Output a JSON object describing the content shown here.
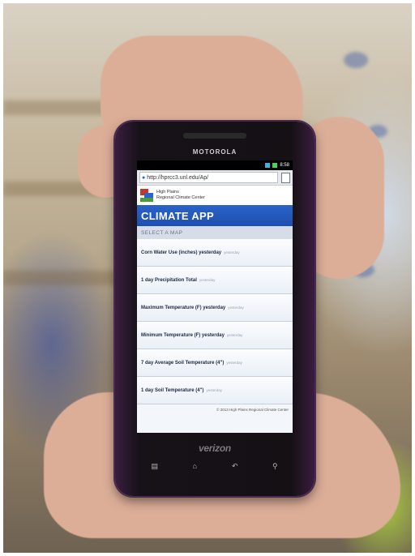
{
  "device": {
    "brand": "MOTOROLA",
    "carrier": "verizon",
    "status_time": "8:58"
  },
  "browser": {
    "url": "http://hprcc3.unl.edu/Ap/"
  },
  "org": {
    "line1": "High Plains",
    "line2": "Regional Climate Center"
  },
  "app": {
    "title": "CLIMATE APP",
    "section_label": "SELECT A MAP",
    "items": [
      {
        "label": "Corn Water Use (inches) yesterday",
        "sub": "yesterday"
      },
      {
        "label": "1 day Precipitation Total",
        "sub": "yesterday"
      },
      {
        "label": "Maximum Temperature (F) yesterday",
        "sub": "yesterday"
      },
      {
        "label": "Minimum Temperature (F) yesterday",
        "sub": "yesterday"
      },
      {
        "label": "7 day Average Soil Temperature (4\")",
        "sub": "yesterday"
      },
      {
        "label": "1 day Soil Temperature (4\")",
        "sub": "yesterday"
      }
    ],
    "footer": "© 2013 High Plains Regional Climate Center"
  },
  "colors": {
    "header_blue": "#1e4fb0",
    "phone_body": "#3a1d3f"
  },
  "icons": [
    "menu-icon",
    "home-icon",
    "back-icon",
    "search-icon"
  ]
}
